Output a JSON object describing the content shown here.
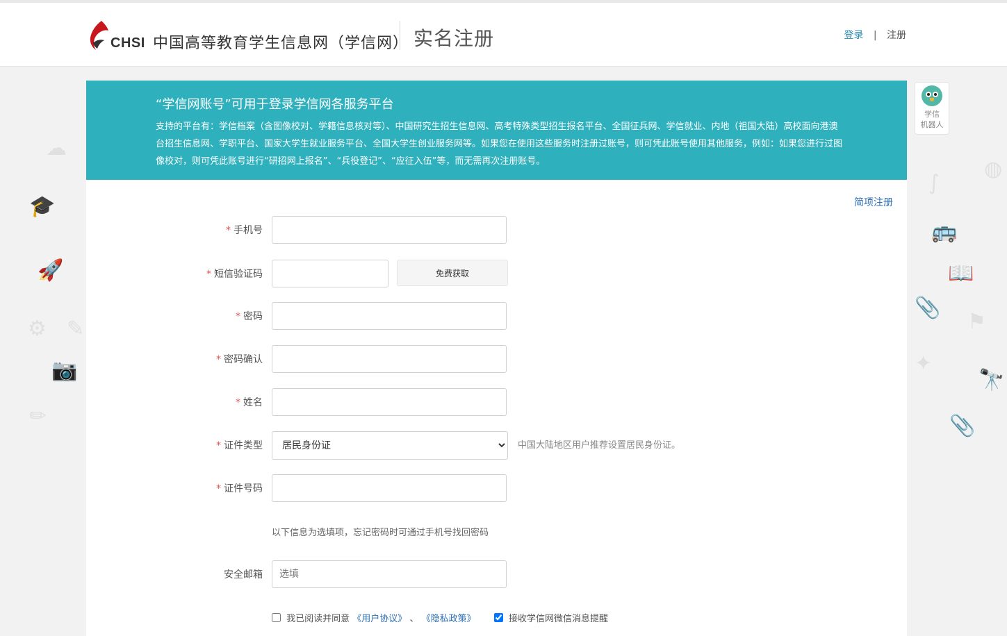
{
  "header": {
    "logo_text": "CHSI",
    "site_name": "中国高等教育学生信息网（学信网）",
    "page_title": "实名注册",
    "login_link": "登录",
    "separator": "|",
    "register_link": "注册"
  },
  "robot": {
    "label_line1": "学信",
    "label_line2": "机器人"
  },
  "banner": {
    "title": "“学信网账号”可用于登录学信网各服务平台",
    "description": "支持的平台有：学信档案（含图像校对、学籍信息核对等）、中国研究生招生信息网、高考特殊类型招生报名平台、全国征兵网、学信就业、内地（祖国大陆）高校面向港澳台招生信息网、学职平台、国家大学生就业服务平台、全国大学生创业服务网等。如果您在使用这些服务时注册过账号，则可凭此账号使用其他服务，例如：如果您进行过图像校对，则可凭此账号进行“研招网上报名”、“兵役登记”、“应征入伍”等，而无需再次注册账号。"
  },
  "simple_register_link": "简项注册",
  "form": {
    "required_mark": "*",
    "phone_label": "手机号",
    "sms_code_label": "短信验证码",
    "get_code_button": "免费获取",
    "password_label": "密码",
    "password_confirm_label": "密码确认",
    "name_label": "姓名",
    "id_type_label": "证件类型",
    "id_type_selected": "居民身份证",
    "id_type_hint": "中国大陆地区用户推荐设置居民身份证。",
    "id_number_label": "证件号码",
    "optional_note": "以下信息为选填项，忘记密码时可通过手机号找回密码",
    "email_label": "安全邮箱",
    "email_placeholder": "选填"
  },
  "agreement": {
    "agree_text": "我已阅读并同意",
    "user_agreement": "《用户协议》",
    "joiner": "、",
    "privacy_policy": "《隐私政策》",
    "wechat_notify": "接收学信网微信消息提醒",
    "agree_checked": false,
    "wechat_checked": true
  },
  "colors": {
    "banner": "#2eb0bd",
    "link": "#2d6fb3",
    "required": "#e45353",
    "logo_red": "#c8161d"
  }
}
